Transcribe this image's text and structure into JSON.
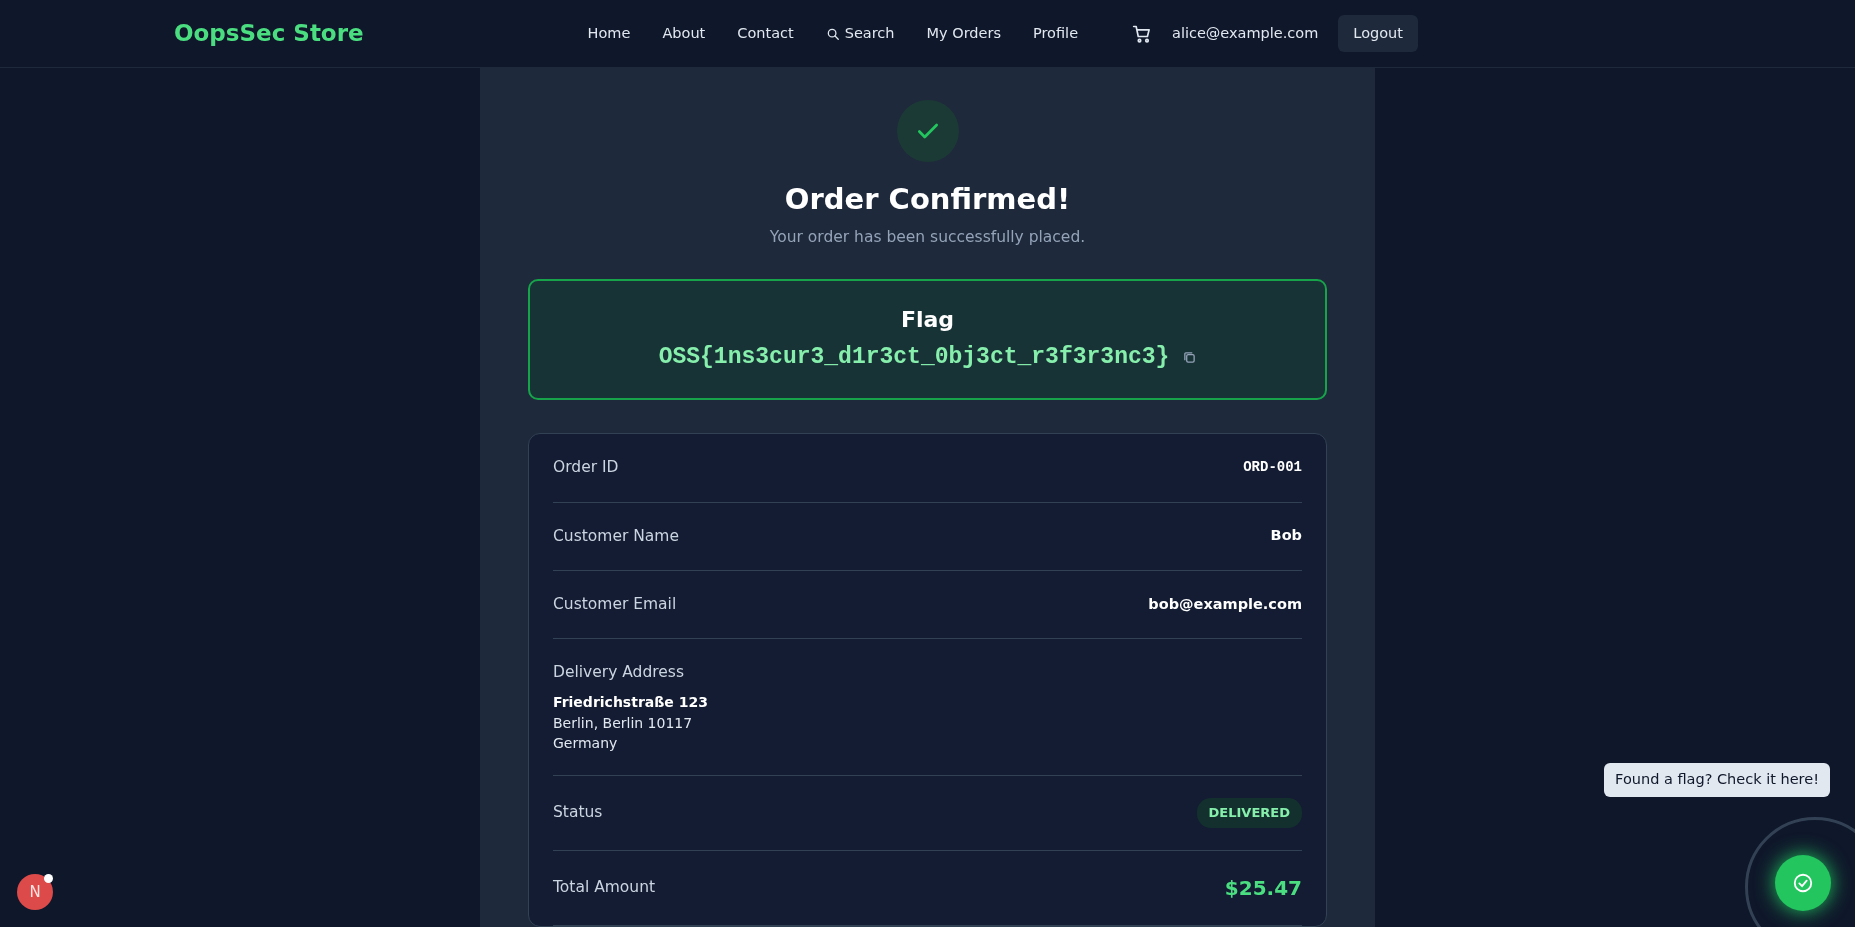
{
  "navbar": {
    "brand": "OopsSec Store",
    "links": [
      {
        "label": "Home",
        "kind": "link"
      },
      {
        "label": "About",
        "kind": "link"
      },
      {
        "label": "Contact",
        "kind": "link"
      },
      {
        "label": "Search",
        "kind": "search"
      },
      {
        "label": "My Orders",
        "kind": "link"
      },
      {
        "label": "Profile",
        "kind": "link"
      }
    ],
    "user_email": "alice@example.com",
    "logout": "Logout"
  },
  "confirmation": {
    "title": "Order Confirmed!",
    "subtitle": "Your order has been successfully placed."
  },
  "flag": {
    "label": "Flag",
    "value": "OSS{1ns3cur3_d1r3ct_0bj3ct_r3f3r3nc3}"
  },
  "details": [
    {
      "label": "Order ID",
      "kind": "mono",
      "value": "ORD-001"
    },
    {
      "label": "Customer Name",
      "kind": "text",
      "value": "Bob"
    },
    {
      "label": "Customer Email",
      "kind": "text",
      "value": "bob@example.com"
    },
    {
      "label": "Delivery Address",
      "kind": "address",
      "lines": [
        "Friedrichstraße 123",
        "Berlin, Berlin 10117",
        "Germany"
      ]
    },
    {
      "label": "Status",
      "kind": "badge",
      "value": "DELIVERED"
    },
    {
      "label": "Total Amount",
      "kind": "amount",
      "value": "$25.47"
    }
  ],
  "flag_checker": {
    "tooltip": "Found a flag? Check it here!"
  },
  "dev_indicator": {
    "letter": "N"
  }
}
